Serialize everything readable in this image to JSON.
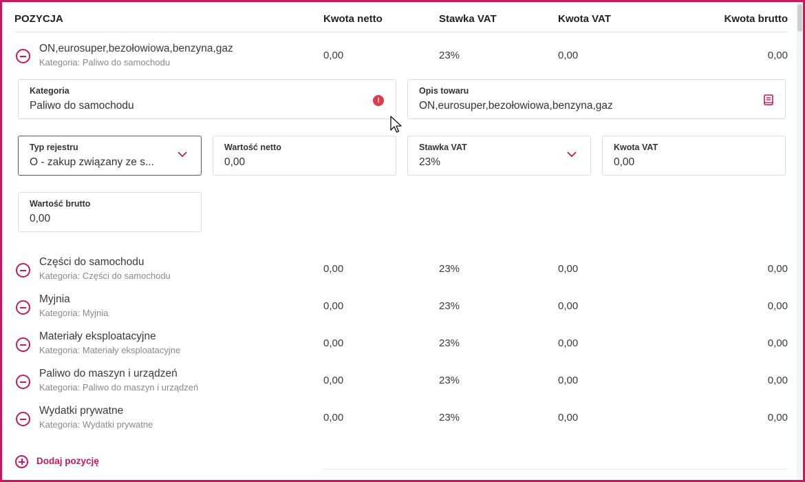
{
  "columns": {
    "position": "POZYCJA",
    "netto": "Kwota netto",
    "vat_rate": "Stawka VAT",
    "vat": "Kwota VAT",
    "brutto": "Kwota brutto"
  },
  "expanded_item": {
    "name": "ON,eurosuper,bezołowiowa,benzyna,gaz",
    "category": "Kategoria: Paliwo do samochodu",
    "netto": "0,00",
    "vat_rate": "23%",
    "vat": "0,00",
    "brutto": "0,00",
    "fields": {
      "kategoria": {
        "label": "Kategoria",
        "value": "Paliwo do samochodu",
        "error_icon": "error-icon"
      },
      "opis": {
        "label": "Opis towaru",
        "value": "ON,eurosuper,bezołowiowa,benzyna,gaz",
        "icon": "book-icon"
      },
      "typ_rejestru": {
        "label": "Typ rejestru",
        "value": "O - zakup związany ze s..."
      },
      "wartosc_netto": {
        "label": "Wartość netto",
        "value": "0,00"
      },
      "stawka_vat": {
        "label": "Stawka VAT",
        "value": "23%"
      },
      "kwota_vat": {
        "label": "Kwota VAT",
        "value": "0,00"
      },
      "wartosc_brutto": {
        "label": "Wartość brutto",
        "value": "0,00"
      }
    }
  },
  "items": [
    {
      "name": "Części do samochodu",
      "category": "Kategoria: Części do samochodu",
      "netto": "0,00",
      "vat_rate": "23%",
      "vat": "0,00",
      "brutto": "0,00"
    },
    {
      "name": "Myjnia",
      "category": "Kategoria: Myjnia",
      "netto": "0,00",
      "vat_rate": "23%",
      "vat": "0,00",
      "brutto": "0,00"
    },
    {
      "name": "Materiały eksploatacyjne",
      "category": "Kategoria: Materiały eksploatacyjne",
      "netto": "0,00",
      "vat_rate": "23%",
      "vat": "0,00",
      "brutto": "0,00"
    },
    {
      "name": "Paliwo do maszyn i urządzeń",
      "category": "Kategoria: Paliwo do maszyn i urządzeń",
      "netto": "0,00",
      "vat_rate": "23%",
      "vat": "0,00",
      "brutto": "0,00"
    },
    {
      "name": "Wydatki prywatne",
      "category": "Kategoria: Wydatki prywatne",
      "netto": "0,00",
      "vat_rate": "23%",
      "vat": "0,00",
      "brutto": "0,00"
    }
  ],
  "add_label": "Dodaj pozycję",
  "colors": {
    "accent": "#c8175d",
    "error": "#e03a4a",
    "border": "#dcdcdc"
  }
}
